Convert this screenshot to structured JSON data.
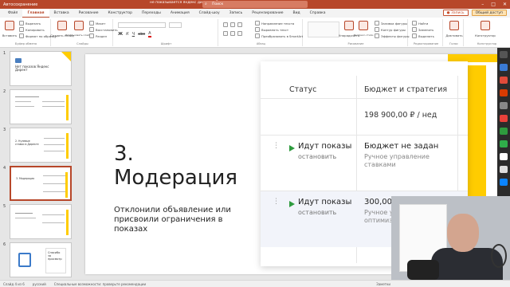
{
  "titlebar": {
    "autosave": "Автосохранение",
    "doc_title": "не показывается яндекс директ • Сохранено в: этот компьютер",
    "search_placeholder": "Поиск",
    "minimize": "–",
    "maximize": "□",
    "close": "✕"
  },
  "tabs": [
    "Файл",
    "Главная",
    "Вставка",
    "Рисование",
    "Конструктор",
    "Переходы",
    "Анимация",
    "Слайд-шоу",
    "Запись",
    "Рецензирование",
    "Вид",
    "Справка"
  ],
  "active_tab": "Главная",
  "tab_record": "● Запись",
  "tab_share": "Общий доступ",
  "ribbon": {
    "paste": "Вставить",
    "cut": "Вырезать",
    "copy": "Копировать",
    "format_painter": "Формат по образцу",
    "clipboard_group": "Буфер обмена",
    "new_slide": "Создать слайд",
    "reuse": "Использовать слайды",
    "layout": "Макет",
    "reset": "Восстановить",
    "section": "Раздел",
    "slides_group": "Слайды",
    "font_group": "Шрифт",
    "paragraph_group": "Абзац",
    "text_direction": "Направление текста",
    "align_text": "Выровнять текст",
    "smartart": "Преобразовать в SmartArt",
    "drawing_group": "Рисование",
    "arrange": "Упорядочить",
    "quick_styles": "Экспресс-стили",
    "shape_fill": "Заливка фигуры",
    "shape_outline": "Контур фигуры",
    "shape_effects": "Эффекты фигуры",
    "find": "Найти",
    "replace": "Заменить",
    "select": "Выделить",
    "editing_group": "Редактирование",
    "dictate": "Диктовать",
    "voice_group": "Голос",
    "designer": "Конструктор",
    "designer_group": "Конструктор"
  },
  "thumbnails": [
    {
      "num": "1",
      "title": "Нет показов Яндекс Директ"
    },
    {
      "num": "2",
      "title": ""
    },
    {
      "num": "3",
      "title": "2. Нулевые ставки в Директе"
    },
    {
      "num": "4",
      "title": "3. Модерация"
    },
    {
      "num": "5",
      "title": ""
    },
    {
      "num": "6",
      "title": "Спасибо за просмотр"
    }
  ],
  "slide": {
    "heading_line1": "3.",
    "heading_line2": "Модерация",
    "body": "Отклонили объявление или присвоили ограничения в показах"
  },
  "table": {
    "col_status": "Статус",
    "col_budget": "Бюджет и стратегия",
    "row1_budget": "198 900,00 ₽ / нед",
    "row2_status": "Идут показы",
    "row2_action": "остановить",
    "row2_budget": "Бюджет не задан",
    "row2_strategy": "Ручное управление ставками",
    "row3_status": "Идут показы",
    "row3_action": "остановить",
    "row3_budget": "300,00 ₽",
    "row3_strategy": "Ручное уп оптимиза"
  },
  "status_bar": {
    "slide_of": "Слайд 4 из 6",
    "language": "русский",
    "accessibility": "Специальные возможности: проверьте рекомендации",
    "notes": "Заметки"
  },
  "colors": {
    "accent": "#b7472a",
    "yandex_yellow": "#ffcc00",
    "play_green": "#2e9b3e"
  }
}
